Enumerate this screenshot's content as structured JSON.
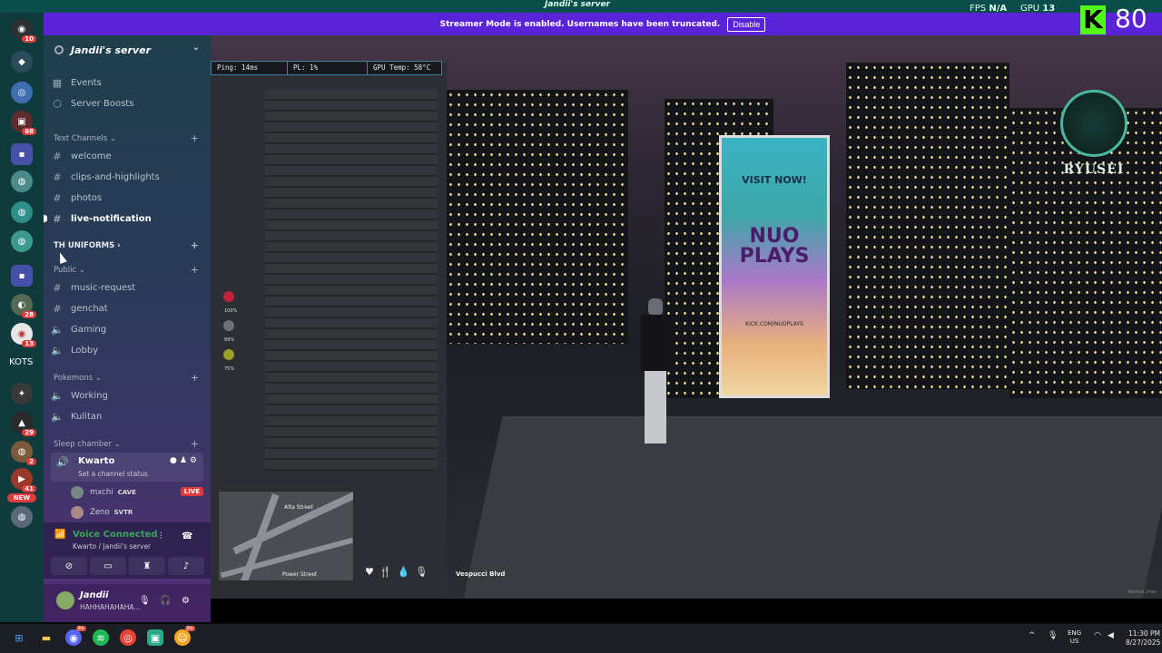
{
  "window": {
    "server_title": "Jandii's server",
    "fps_label": "FPS",
    "fps_value": "N/A",
    "gpu_label": "GPU",
    "gpu_value": "13"
  },
  "streamer_banner": {
    "message": "Streamer Mode is enabled. Usernames have been truncated.",
    "disable_label": "Disable"
  },
  "kick_overlay": {
    "logo_letter": "K",
    "value": "80"
  },
  "rail": {
    "badges": [
      "10",
      "68",
      "28",
      "13",
      "29",
      "2",
      "41"
    ],
    "kots_label": "KOTS",
    "new_label": "NEW"
  },
  "sidebar": {
    "server_name": "Jandii's server",
    "top_items": [
      {
        "label": "Events",
        "icon": "calendar-icon"
      },
      {
        "label": "Server Boosts",
        "icon": "boost-icon"
      }
    ],
    "categories": {
      "text": "Text Channels",
      "th": "TH UNIFORMS",
      "public": "Public",
      "pokemons": "Pokemons",
      "sleep": "Sleep chamber"
    },
    "text_channels": [
      "welcome",
      "clips-and-highlights",
      "photos",
      "live-notification"
    ],
    "public_channels": [
      "music-request",
      "genchat",
      "Gaming",
      "Lobby"
    ],
    "pokemon_channels": [
      "Working",
      "Kulitan"
    ],
    "voice_channel": {
      "name": "Kwarto",
      "status": "Set a channel status",
      "users": [
        {
          "name": "mxchi",
          "tag": "CAVE",
          "live": "LIVE"
        },
        {
          "name": "Zeno",
          "tag": "SVTR"
        }
      ]
    }
  },
  "voice_panel": {
    "title": "Voice Connected",
    "subtitle": "Kwarto / Jandii's server"
  },
  "user_panel": {
    "name": "Jandii",
    "status": "HAHHAHAHAHA..."
  },
  "game": {
    "stats": {
      "ping": "Ping: 14ms",
      "pl": "PL: 1%",
      "gpu_temp": "GPU Temp: 58°C"
    },
    "billboard": {
      "visit": "VISIT NOW!",
      "brand": "NUO PLAYS",
      "url": "KICK.COM/NUOPLAYS"
    },
    "hud_levels": [
      "100%",
      "89%",
      "75%"
    ],
    "street": "Vespucci Blvd",
    "minimap_labels": [
      "Alta Street",
      "Power Street"
    ],
    "crest_name": "RYUSEI",
    "graphics_label": "Normal (Han"
  },
  "taskbar": {
    "lang_top": "ENG",
    "lang_bottom": "US",
    "time": "11:30 PM",
    "date": "8/27/2025",
    "badges": [
      "9+",
      "9+"
    ]
  },
  "colors": {
    "rail_bg": "#0f3b3d",
    "banner_bg": "#5b23d6",
    "voice_green": "#3ba55c",
    "live_red": "#e23b3b",
    "kick_green": "#53fc18"
  }
}
